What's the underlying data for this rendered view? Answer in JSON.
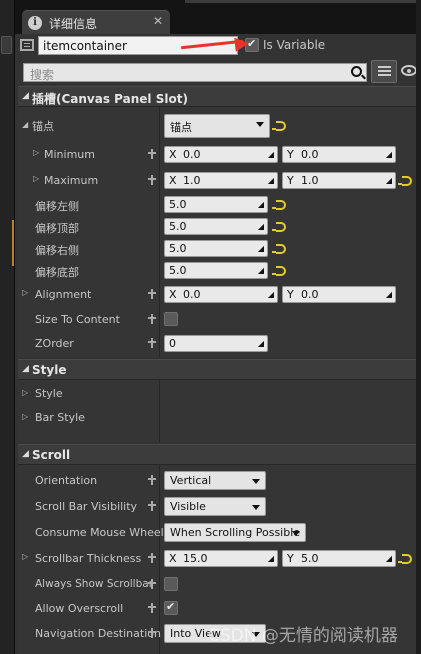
{
  "tab": {
    "title": "详细信息",
    "close": "✕"
  },
  "widget": {
    "name": "itemcontainer",
    "is_variable_label": "Is Variable",
    "is_variable": true
  },
  "search": {
    "placeholder": "搜索"
  },
  "sections": {
    "slot": {
      "title": "插槽(Canvas Panel Slot)",
      "anchors_label": "锚点",
      "anchors_value": "锚点",
      "minimum_label": "Minimum",
      "minimum": {
        "x": "0.0",
        "y": "0.0"
      },
      "maximum_label": "Maximum",
      "maximum": {
        "x": "1.0",
        "y": "1.0"
      },
      "offset_left_label": "偏移左侧",
      "offset_left": "5.0",
      "offset_top_label": "偏移顶部",
      "offset_top": "5.0",
      "offset_right_label": "偏移右侧",
      "offset_right": "5.0",
      "offset_bottom_label": "偏移底部",
      "offset_bottom": "5.0",
      "alignment_label": "Alignment",
      "alignment": {
        "x": "0.0",
        "y": "0.0"
      },
      "size_to_content_label": "Size To Content",
      "size_to_content": false,
      "zorder_label": "ZOrder",
      "zorder": "0"
    },
    "style": {
      "title": "Style",
      "style_label": "Style",
      "bar_style_label": "Bar Style"
    },
    "scroll": {
      "title": "Scroll",
      "orientation_label": "Orientation",
      "orientation": "Vertical",
      "scroll_bar_visibility_label": "Scroll Bar Visibility",
      "scroll_bar_visibility": "Visible",
      "consume_mouse_wheel_label": "Consume Mouse Wheel",
      "consume_mouse_wheel": "When Scrolling Possible",
      "scrollbar_thickness_label": "Scrollbar Thickness",
      "scrollbar_thickness": {
        "x": "15.0",
        "y": "5.0"
      },
      "always_show_scrollbar_label": "Always Show Scrollbar",
      "always_show_scrollbar": false,
      "allow_overscroll_label": "Allow Overscroll",
      "allow_overscroll": true,
      "navigation_destination_label": "Navigation Destination",
      "navigation_destination": "Into View"
    }
  },
  "axis": {
    "x": "X",
    "y": "Y"
  },
  "watermark": "CSDN @无情的阅读机器",
  "colors": {
    "accent_reset": "#e2cb2a",
    "arrow": "#e8332b",
    "panel": "#333333"
  }
}
